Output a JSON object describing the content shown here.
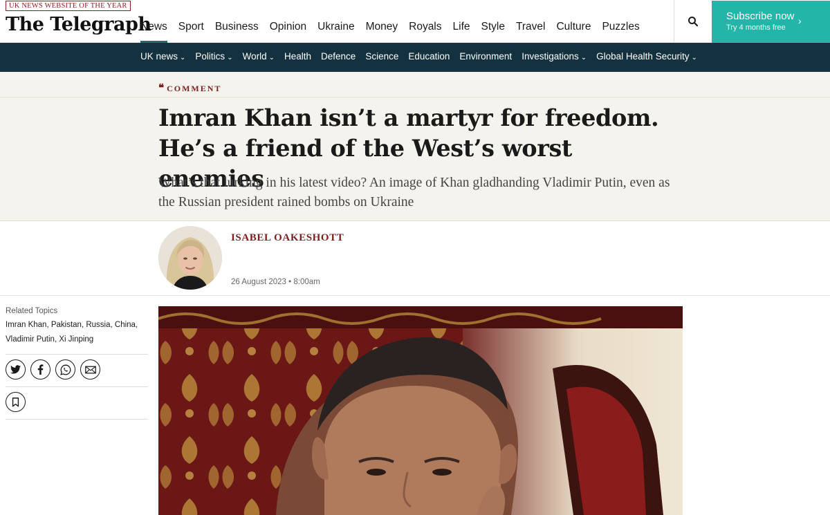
{
  "header": {
    "award": "UK NEWS WEBSITE OF THE YEAR",
    "logo": "The Telegraph",
    "nav": [
      "News",
      "Sport",
      "Business",
      "Opinion",
      "Ukraine",
      "Money",
      "Royals",
      "Life",
      "Style",
      "Travel",
      "Culture",
      "Puzzles"
    ],
    "active_nav": "News",
    "search_icon": "search-icon",
    "subscribe": {
      "label": "Subscribe now",
      "sub": "Try 4 months free",
      "icon": "chevron-right-icon"
    }
  },
  "section_nav": {
    "items": [
      {
        "label": "UK news",
        "dropdown": true
      },
      {
        "label": "Politics",
        "dropdown": true
      },
      {
        "label": "World",
        "dropdown": true
      },
      {
        "label": "Health",
        "dropdown": false
      },
      {
        "label": "Defence",
        "dropdown": false
      },
      {
        "label": "Science",
        "dropdown": false
      },
      {
        "label": "Education",
        "dropdown": false
      },
      {
        "label": "Environment",
        "dropdown": false
      },
      {
        "label": "Investigations",
        "dropdown": true
      },
      {
        "label": "Global Health Security",
        "dropdown": true
      }
    ]
  },
  "article": {
    "kicker": "COMMENT",
    "kicker_icon": "quote-icon",
    "headline": "Imran Khan isn’t a martyr for freedom. He’s a friend of the West’s worst enemies",
    "standfirst": "What’s that lurking in his latest video? An image of Khan gladhanding Vladimir Putin, even as the Russian president rained bombs on Ukraine",
    "author": "ISABEL OAKESHOTT",
    "date": "26 August 2023 • 8:00am"
  },
  "sidebar": {
    "related_label": "Related Topics",
    "topics": [
      "Imran Khan",
      "Pakistan",
      "Russia",
      "China",
      "Vladimir Putin",
      "Xi Jinping"
    ],
    "share_icons": [
      "twitter-icon",
      "facebook-icon",
      "whatsapp-icon",
      "email-icon"
    ],
    "save_icon": "bookmark-icon"
  },
  "colors": {
    "accent": "#23b5a7",
    "section_nav_bg": "#13313e",
    "comment_red": "#7a1f1f",
    "band_bg": "#f5f3ee"
  }
}
